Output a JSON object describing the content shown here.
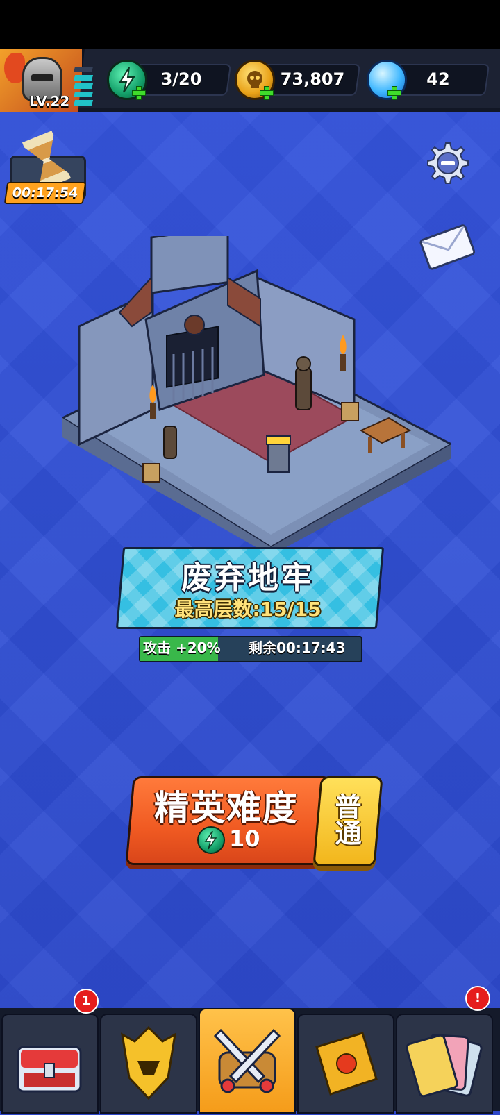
{
  "player": {
    "level": "LV.22",
    "xp_segments_filled": 4,
    "xp_segments_total": 5
  },
  "resources": {
    "energy": {
      "value": "3/20",
      "icon": "energy-bolt-icon"
    },
    "gold": {
      "value": "73,807",
      "icon": "skull-coin-icon"
    },
    "gems": {
      "value": "42",
      "icon": "blue-gem-icon"
    }
  },
  "idle_timer": {
    "value": "00:17:54",
    "icon": "hourglass-icon"
  },
  "dungeon": {
    "name": "废弃地牢",
    "max_floor": "最高层数:15/15",
    "buff": "攻击 +20%",
    "remaining": "剩余00:17:43"
  },
  "actions": {
    "elite": {
      "label": "精英难度",
      "cost": "10",
      "cost_icon": "energy-bolt-icon"
    },
    "normal": {
      "label": "普通"
    }
  },
  "nav": {
    "tabs": [
      {
        "name": "chest",
        "icon": "treasure-chest-icon",
        "badge": "1"
      },
      {
        "name": "hero",
        "icon": "golden-helmet-icon",
        "badge": ""
      },
      {
        "name": "battle",
        "icon": "crossed-swords-icon",
        "badge": "",
        "active": true
      },
      {
        "name": "book",
        "icon": "spellbook-icon",
        "badge": ""
      },
      {
        "name": "cards",
        "icon": "cards-icon",
        "badge": "!"
      }
    ]
  },
  "colors": {
    "background": "#3150d6",
    "elite_button": "#f05a22",
    "normal_button": "#f2b61c",
    "card": "#35bfe2",
    "active_tab": "#f59c1a",
    "badge": "#e51d1d"
  }
}
